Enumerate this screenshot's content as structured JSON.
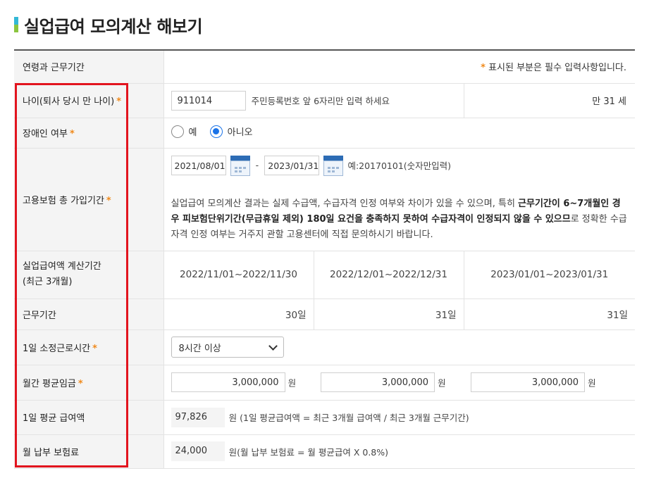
{
  "page": {
    "title": "실업급여 모의계산 해보기",
    "colors": {
      "accent_blue": "#33b8d6",
      "accent_green": "#8bc53f",
      "required_star": "#f08a1c",
      "highlight_box": "#e2141e",
      "radio_selected": "#1a73e8"
    }
  },
  "header_row": {
    "label": "연령과 근무기간",
    "required_star": "*",
    "required_note": "표시된 부분은 필수 입력사항입니다."
  },
  "age": {
    "label": "나이(퇴사 당시 만 나이)",
    "value": "911014",
    "hint": "주민등록번호 앞 6자리만 입력 하세요",
    "result": "만 31 세"
  },
  "disability": {
    "label": "장애인 여부",
    "options": [
      {
        "label": "예",
        "selected": false
      },
      {
        "label": "아니오",
        "selected": true
      }
    ]
  },
  "insurance_period": {
    "label": "고용보험 총 가입기간",
    "start": "2021/08/01",
    "separator": "-",
    "end": "2023/01/31",
    "example": "예:20170101(숫자만입력)",
    "note_part1": "실업급여 모의계산 결과는 실제 수급액, 수급자격 인정 여부와 차이가 있을 수 있으며, 특히 ",
    "note_bold": "근무기간이 6~7개월인 경우 피보험단위기간(무급휴일 제외) 180일 요건을 충족하지 못하여 수급자격이 인정되지 않을 수 있으므",
    "note_part2": "로 정확한 수급자격 인정 여부는 거주지 관할 고용센터에 직접 문의하시기 바랍니다."
  },
  "calc_period": {
    "label_line1": "실업급여액 계산기간",
    "label_line2": "(최근 3개월)",
    "periods": [
      "2022/11/01~2022/11/30",
      "2022/12/01~2022/12/31",
      "2023/01/01~2023/01/31"
    ]
  },
  "work_days": {
    "label": "근무기간",
    "values": [
      "30일",
      "31일",
      "31일"
    ]
  },
  "daily_hours": {
    "label": "1일 소정근로시간",
    "selected": "8시간 이상"
  },
  "monthly_wage": {
    "label": "월간 평균임금",
    "values": [
      "3,000,000",
      "3,000,000",
      "3,000,000"
    ],
    "unit": "원"
  },
  "daily_benefit": {
    "label": "1일 평균 급여액",
    "value": "97,826",
    "desc": "원 (1일 평균급여액 = 최근 3개월 급여액 / 최근 3개월 근무기간)"
  },
  "monthly_premium": {
    "label": "월 납부 보험료",
    "value": "24,000",
    "desc": "원(월 납부 보험료 = 월 평균급여 X 0.8%)"
  }
}
